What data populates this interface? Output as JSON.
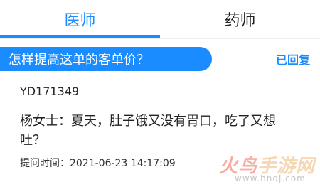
{
  "tabs": [
    {
      "label": "医师",
      "active": true
    },
    {
      "label": "药师",
      "active": false
    }
  ],
  "question": {
    "title": "怎样提高这单的客单价？",
    "status": "已回复",
    "id": "YD171349",
    "body": "杨女士：夏天，肚子饿又没有胃口，吃了又想吐？",
    "time_label": "提问时间：",
    "time_value": "2021-06-23 14:17:09"
  },
  "watermark": {
    "logo_part1": "火鸟",
    "logo_part2": "手游网",
    "url": "www.hnqj.com"
  },
  "colors": {
    "accent": "#1a8cff",
    "text": "#222222",
    "background": "#ffffff"
  }
}
